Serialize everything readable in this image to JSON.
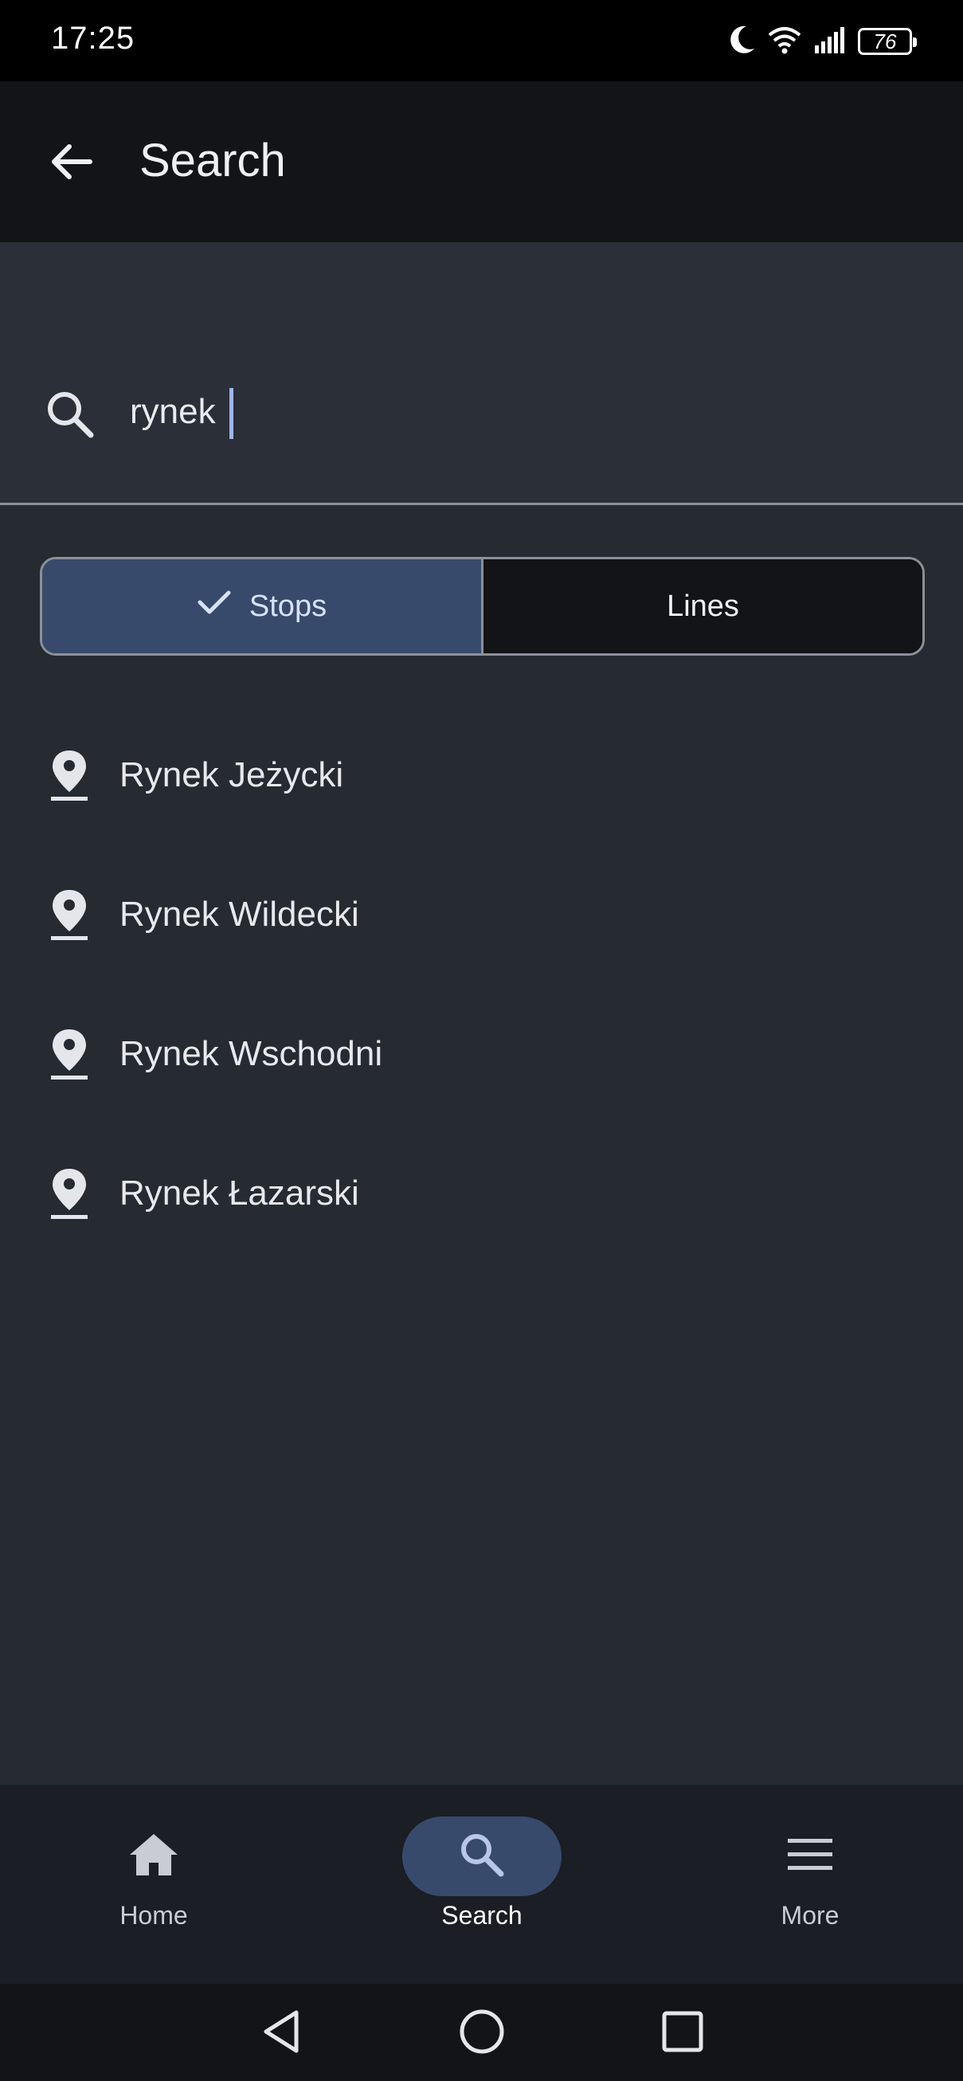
{
  "status_bar": {
    "time": "17:25",
    "battery": "76",
    "icons": [
      "moon-icon",
      "wifi-icon",
      "signal-icon",
      "battery-icon"
    ]
  },
  "app_bar": {
    "title": "Search",
    "back_icon": "arrow-left-icon"
  },
  "search": {
    "value": "rynek",
    "icon": "search-icon"
  },
  "segmented": {
    "stops_label": "Stops",
    "lines_label": "Lines",
    "selected": "Stops"
  },
  "results": [
    {
      "label": "Rynek Jeżycki"
    },
    {
      "label": "Rynek Wildecki"
    },
    {
      "label": "Rynek Wschodni"
    },
    {
      "label": "Rynek Łazarski"
    }
  ],
  "bottom_nav": {
    "home_label": "Home",
    "search_label": "Search",
    "more_label": "More",
    "active": "Search"
  },
  "colors": {
    "background": "#262a31",
    "app_bar": "#121418",
    "accent": "#374a6c",
    "caret": "#9fb6ec"
  }
}
